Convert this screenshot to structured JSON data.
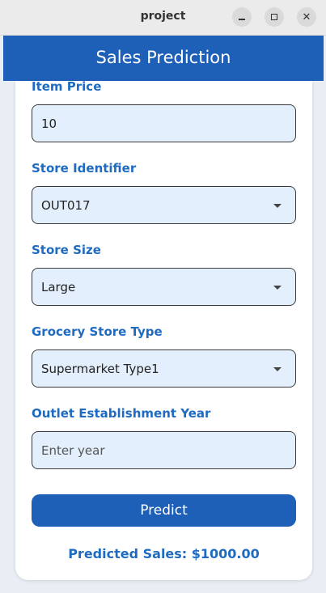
{
  "window": {
    "title": "project",
    "minimize_icon": "minimize-icon",
    "maximize_icon": "maximize-icon",
    "close_icon": "close-icon"
  },
  "appbar": {
    "title": "Sales Prediction"
  },
  "form": {
    "item_price": {
      "label": "Item Price",
      "value": "10"
    },
    "store_identifier": {
      "label": "Store Identifier",
      "value": "OUT017"
    },
    "store_size": {
      "label": "Store Size",
      "value": "Large"
    },
    "grocery_store_type": {
      "label": "Grocery Store Type",
      "value": "Supermarket Type1"
    },
    "establishment_year": {
      "label": "Outlet Establishment Year",
      "placeholder": "Enter year",
      "value": ""
    },
    "predict_label": "Predict"
  },
  "result": {
    "text": "Predicted Sales: $1000.00"
  },
  "colors": {
    "primary": "#1e5fb8",
    "label": "#1e6bc1",
    "field_bg": "#e3effc"
  }
}
